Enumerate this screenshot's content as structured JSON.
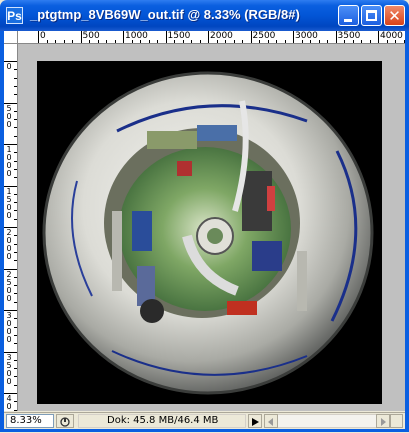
{
  "window": {
    "title": "_ptgtmp_8VB69W_out.tif @ 8.33% (RGB/8#)",
    "app_icon_glyph": "Ps",
    "close_glyph": "✕"
  },
  "rulers": {
    "horizontal": [
      "0",
      "500",
      "1000",
      "1500",
      "2000",
      "2500",
      "3000",
      "3500",
      "4000"
    ],
    "vertical": [
      "0",
      "500",
      "1000",
      "1500",
      "2000",
      "2500",
      "3000",
      "3500",
      "4000"
    ]
  },
  "document": {
    "description_icon": "photoshop-document-icon"
  },
  "status": {
    "zoom": "8.33%",
    "doc_info": "Dok: 45.8 MB/46.4 MB"
  },
  "icons": {
    "status_menu_arrow": "play-triangle-icon",
    "status_info": "document-info-icon",
    "scroll_left": "arrow-left-icon",
    "scroll_right": "arrow-right-icon"
  },
  "colors": {
    "titlebar": "#0a5fe0",
    "close_button": "#d8421a",
    "canvas_bg": "#c0c0c0",
    "document_bg": "#000000"
  }
}
